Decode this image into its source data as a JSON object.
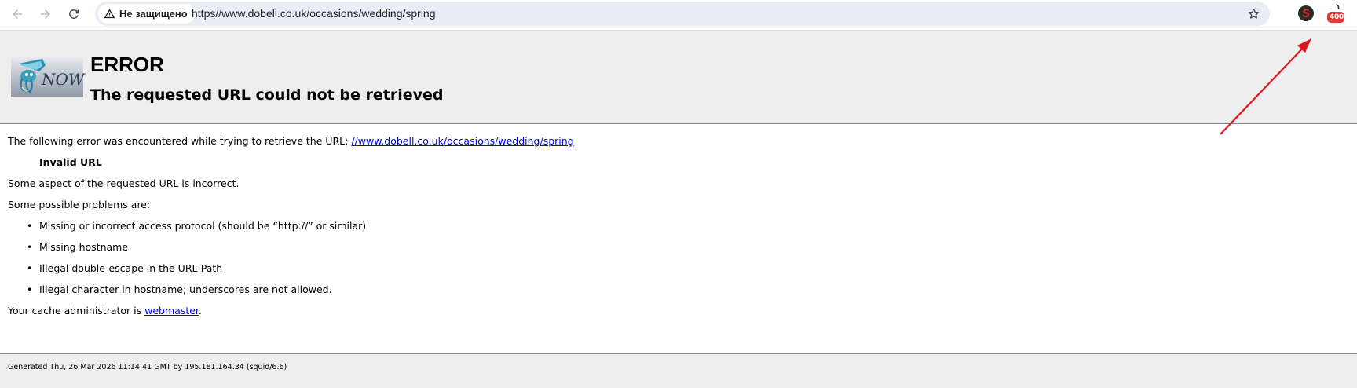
{
  "browser": {
    "security_label": "Не защищено",
    "url": "https//www.dobell.co.uk/occasions/wedding/spring",
    "extensions": [
      {
        "icon": "s-extension-icon",
        "color": "#d32f2f"
      },
      {
        "icon": "http-status-extension-icon",
        "badge": "400",
        "color": "#e53935"
      }
    ]
  },
  "error_page": {
    "logo_text": "NOW",
    "title": "ERROR",
    "subtitle": "The requested URL could not be retrieved",
    "intro": "The following error was encountered while trying to retrieve the URL: ",
    "intro_link": "//www.dobell.co.uk/occasions/wedding/spring",
    "error_name": "Invalid URL",
    "description": "Some aspect of the requested URL is incorrect.",
    "problems_heading": "Some possible problems are:",
    "problems": [
      "Missing or incorrect access protocol (should be “http://” or similar)",
      "Missing hostname",
      "Illegal double-escape in the URL-Path",
      "Illegal character in hostname; underscores are not allowed."
    ],
    "admin_prefix": "Your cache administrator is ",
    "admin_link": "webmaster",
    "admin_suffix": ".",
    "footer": "Generated Thu, 26 Mar 2026 11:14:41 GMT by 195.181.164.34 (squid/6.6)"
  },
  "annotation": {
    "arrow_color": "#e0141e"
  }
}
